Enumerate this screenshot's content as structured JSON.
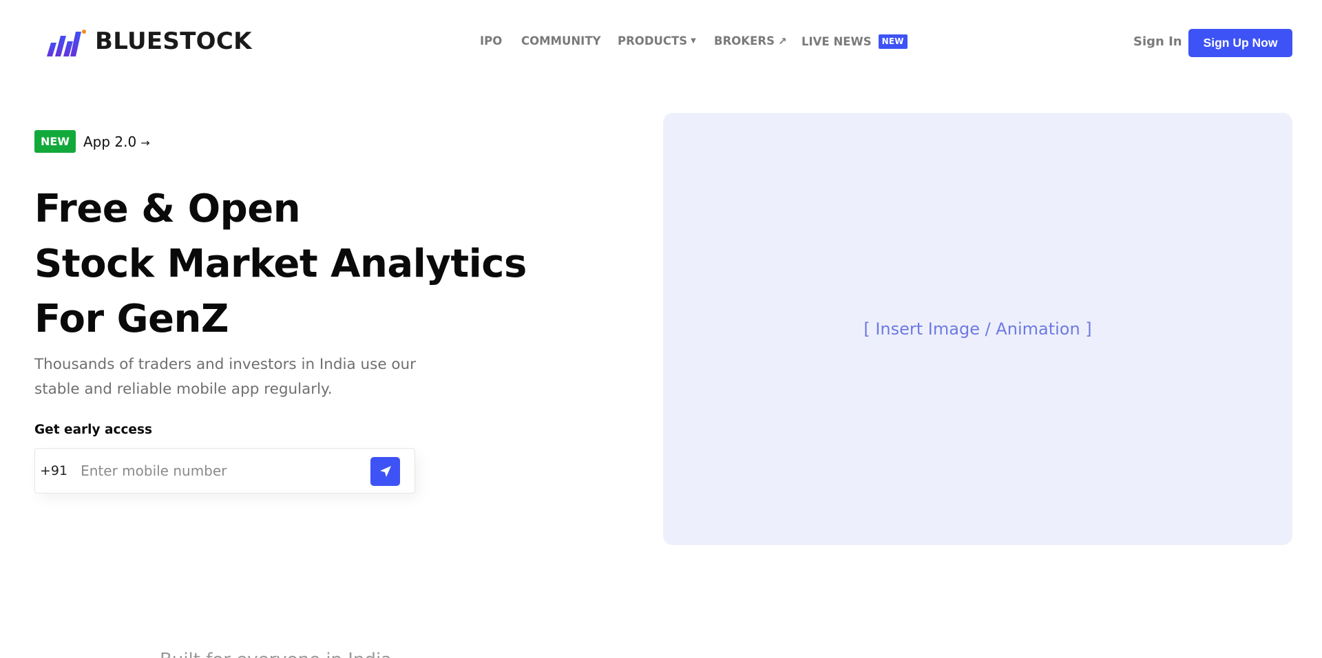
{
  "brand": {
    "name": "BLUESTOCK",
    "logo_icon": "bluestock-logo-icon",
    "accent": "#3d53f5"
  },
  "nav": {
    "items": [
      {
        "label": "IPO"
      },
      {
        "label": "COMMUNITY"
      },
      {
        "label": "PRODUCTS",
        "icon": "caret-down-icon"
      },
      {
        "label": "BROKERS",
        "icon": "arrow-up-right-icon"
      },
      {
        "label": "LIVE NEWS",
        "badge": "NEW"
      }
    ]
  },
  "auth": {
    "signin_label": "Sign In",
    "signup_label": "Sign Up Now"
  },
  "hero": {
    "announcement": {
      "badge": "NEW",
      "text": "App 2.0",
      "arrow": "→",
      "badge_color": "#12a93b"
    },
    "title_lines": [
      "Free & Open",
      "Stock Market Analytics",
      "For GenZ"
    ],
    "subtitle": "Thousands of traders and investors in India use our stable and reliable mobile app regularly.",
    "early_access_label": "Get early access",
    "phone": {
      "country_code": "+91",
      "placeholder": "Enter mobile number",
      "value": "",
      "send_icon": "send-icon"
    },
    "media_placeholder": "[ Insert Image / Animation ]"
  },
  "partial_section_text": "Built for everyone in India"
}
